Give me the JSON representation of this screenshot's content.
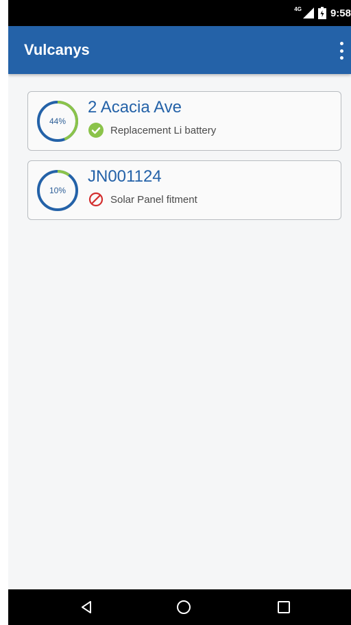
{
  "status_bar": {
    "network": "4G",
    "time": "9:58",
    "icons": [
      "signal-icon",
      "battery-icon"
    ]
  },
  "app_bar": {
    "title": "Vulcanys",
    "menu_icon": "more-vert-icon"
  },
  "jobs": [
    {
      "progress_label": "44%",
      "progress": 0.44,
      "title": "2 Acacia Ave",
      "status_icon": "check-circle-icon",
      "status_color": "#8bc34a",
      "description": "Replacement Li battery"
    },
    {
      "progress_label": "10%",
      "progress": 0.1,
      "title": "JN001124",
      "status_icon": "prohibited-icon",
      "status_color": "#d32f2f",
      "description": "Solar Panel fitment"
    }
  ],
  "nav_bar": {
    "icons": [
      "back-icon",
      "home-icon",
      "recents-icon"
    ]
  },
  "colors": {
    "primary": "#2462a8",
    "ring_track": "#2462a8",
    "ring_fill": "#8bc34a"
  }
}
